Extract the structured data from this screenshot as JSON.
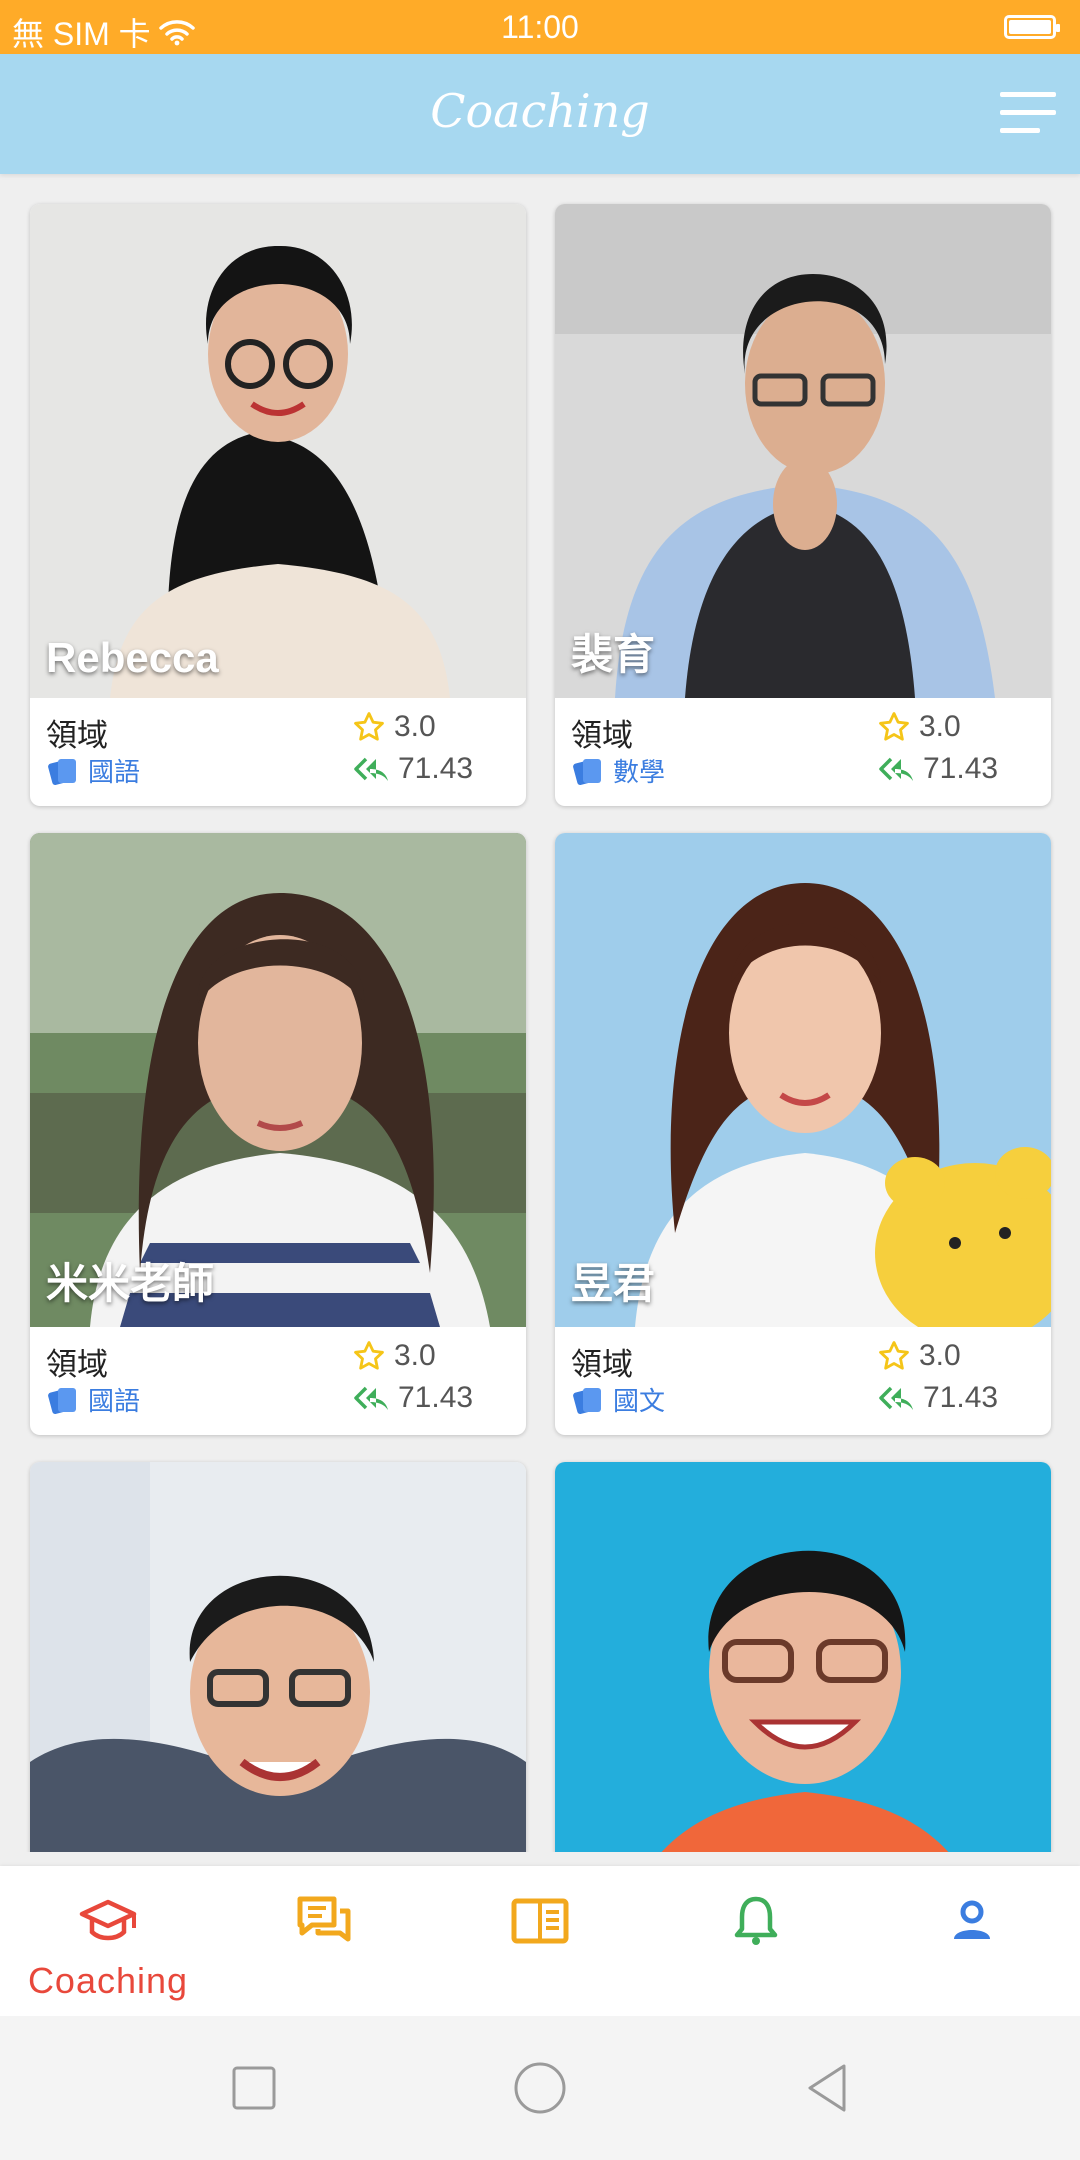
{
  "status_bar": {
    "carrier": "無 SIM 卡",
    "time": "11:00"
  },
  "app_bar": {
    "title": "Coaching",
    "menu_icon": "hamburger-menu-icon"
  },
  "labels": {
    "field": "領域"
  },
  "teachers": [
    {
      "name": "Rebecca",
      "subject": "國語",
      "rating": "3.0",
      "reply_rate": "71.43"
    },
    {
      "name": "裴育",
      "subject": "數學",
      "rating": "3.0",
      "reply_rate": "71.43"
    },
    {
      "name": "米米老師",
      "subject": "國語",
      "rating": "3.0",
      "reply_rate": "71.43"
    },
    {
      "name": "昱君",
      "subject": "國文",
      "rating": "3.0",
      "reply_rate": "71.43"
    },
    {
      "name": "",
      "subject": "",
      "rating": "",
      "reply_rate": ""
    },
    {
      "name": "",
      "subject": "",
      "rating": "",
      "reply_rate": ""
    }
  ],
  "bottom_nav": [
    {
      "label": "Coaching",
      "icon": "graduation-cap-icon",
      "active": true,
      "color": "#e8483b"
    },
    {
      "label": "",
      "icon": "chat-bubbles-icon",
      "active": false,
      "color": "#f2a81d"
    },
    {
      "label": "",
      "icon": "book-icon",
      "active": false,
      "color": "#f2a81d"
    },
    {
      "label": "",
      "icon": "bell-icon",
      "active": false,
      "color": "#3fae5a"
    },
    {
      "label": "",
      "icon": "profile-icon",
      "active": false,
      "color": "#3b7de0"
    }
  ],
  "colors": {
    "status_bar": "#ffab28",
    "app_bar": "#a7d8f0",
    "accent_red": "#e8483b",
    "subject_blue": "#3b7de0",
    "star": "#f5c518",
    "reply_green": "#3fae5a"
  }
}
